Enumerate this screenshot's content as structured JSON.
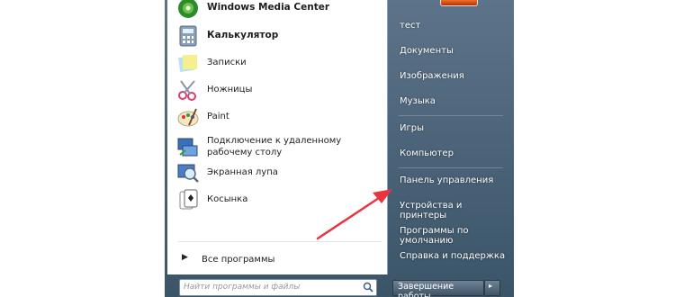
{
  "programs": [
    {
      "label": "Windows Media Center",
      "bold": true,
      "icon": "media-center-icon"
    },
    {
      "label": "Калькулятор",
      "bold": true,
      "icon": "calculator-icon"
    },
    {
      "label": "Записки",
      "bold": false,
      "icon": "sticky-notes-icon"
    },
    {
      "label": "Ножницы",
      "bold": false,
      "icon": "scissors-icon"
    },
    {
      "label": "Paint",
      "bold": false,
      "icon": "paint-icon"
    },
    {
      "label": "Подключение к удаленному рабочему столу",
      "bold": false,
      "icon": "remote-desktop-icon"
    },
    {
      "label": "Экранная лупа",
      "bold": false,
      "icon": "magnifier-icon"
    },
    {
      "label": "Косынка",
      "bold": false,
      "icon": "solitaire-icon"
    }
  ],
  "all_programs": "Все программы",
  "search": {
    "placeholder": "Найти программы и файлы"
  },
  "right_items": [
    {
      "label": "тест"
    },
    {
      "label": "Документы"
    },
    {
      "label": "Изображения"
    },
    {
      "label": "Музыка"
    },
    {
      "label": "Игры"
    },
    {
      "label": "Компьютер"
    },
    {
      "label": "Панель управления"
    },
    {
      "label": "Устройства и принтеры"
    },
    {
      "label": "Программы по умолчанию"
    },
    {
      "label": "Справка и поддержка"
    }
  ],
  "shutdown": {
    "label": "Завершение работы",
    "arrow": "▸"
  },
  "colors": {
    "right_panel_top": "#5d7389",
    "right_panel_bottom": "#3a5468",
    "annotation_arrow": "#e8343f"
  }
}
